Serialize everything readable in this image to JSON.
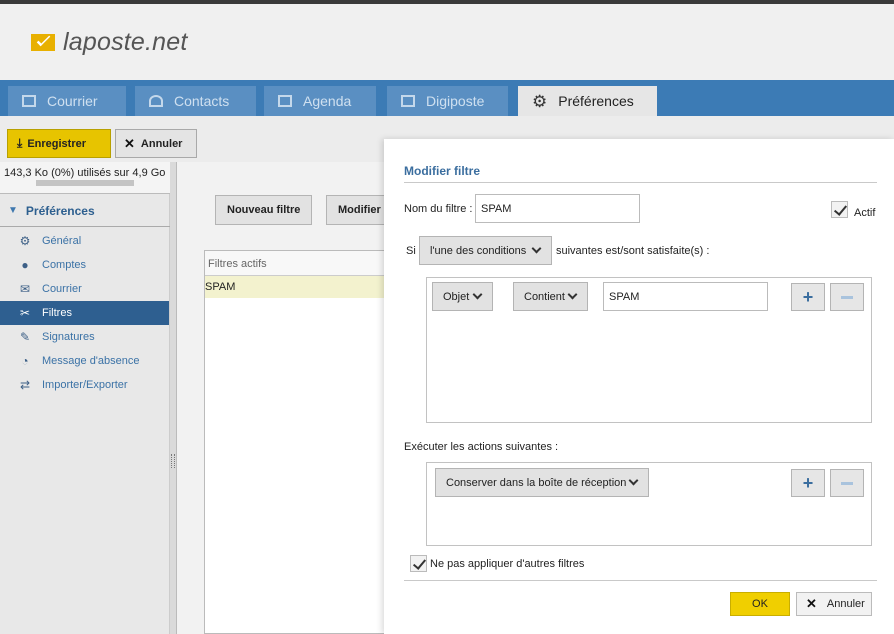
{
  "app": {
    "logo_text": "laposte.net"
  },
  "nav": {
    "tabs": [
      {
        "label": "Courrier",
        "icon": "mail-icon"
      },
      {
        "label": "Contacts",
        "icon": "contacts-icon"
      },
      {
        "label": "Agenda",
        "icon": "calendar-icon"
      },
      {
        "label": "Digiposte",
        "icon": "digiposte-icon"
      },
      {
        "label": "Préférences",
        "icon": "gear-icon"
      }
    ]
  },
  "toolbar": {
    "save_label": "Enregistrer",
    "cancel_label": "Annuler"
  },
  "sidebar": {
    "quota": "143,3 Ko (0%) utilisés sur 4,9 Go",
    "heading": "Préférences",
    "items": [
      {
        "label": "Général",
        "icon": "gear-icon"
      },
      {
        "label": "Comptes",
        "icon": "user-icon"
      },
      {
        "label": "Courrier",
        "icon": "mail-icon"
      },
      {
        "label": "Filtres",
        "icon": "filter-icon"
      },
      {
        "label": "Signatures",
        "icon": "pen-icon"
      },
      {
        "label": "Message d'absence",
        "icon": "absence-icon"
      },
      {
        "label": "Importer/Exporter",
        "icon": "import-export-icon"
      }
    ]
  },
  "content": {
    "new_filter_label": "Nouveau filtre",
    "modify_label": "Modifier",
    "filters_header": "Filtres actifs",
    "filters": [
      "SPAM"
    ]
  },
  "dialog": {
    "title": "Modifier filtre",
    "name_label": "Nom du filtre :",
    "name_value": "SPAM",
    "active_label": "Actif",
    "if_label": "Si",
    "condition_mode": "l'une des conditions",
    "condition_suffix": "suivantes est/sont satisfaite(s) :",
    "condition": {
      "field": "Objet",
      "operator": "Contient",
      "value": "SPAM"
    },
    "actions_label": "Exécuter les actions suivantes :",
    "action": "Conserver dans la boîte de réception",
    "no_other_filters_label": "Ne pas appliquer d'autres filtres",
    "ok_label": "OK",
    "cancel_label": "Annuler"
  }
}
